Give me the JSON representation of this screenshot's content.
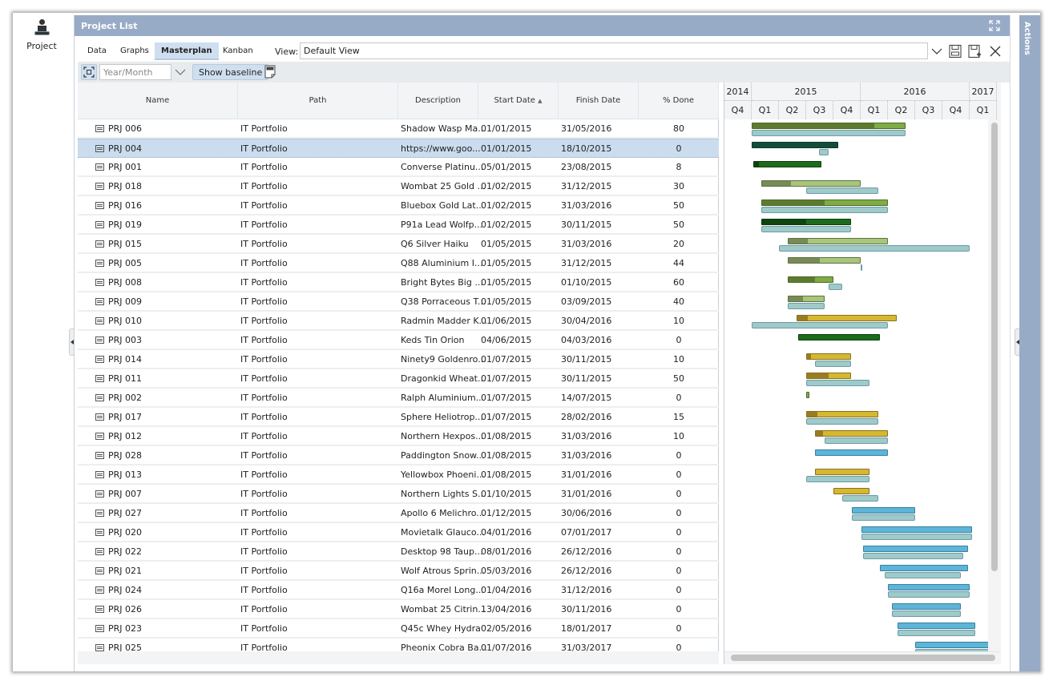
{
  "left_nav": {
    "item_label": "Project"
  },
  "panel": {
    "title": "Project List"
  },
  "tabs": [
    {
      "label": "Data",
      "active": false
    },
    {
      "label": "Graphs",
      "active": false
    },
    {
      "label": "Masterplan",
      "active": true
    },
    {
      "label": "Kanban",
      "active": false
    }
  ],
  "view": {
    "label": "View:",
    "value": "Default View"
  },
  "toolbar": {
    "scale_placeholder": "Year/Month",
    "show_baseline_label": "Show baseline"
  },
  "actions_label": "Actions",
  "grid": {
    "columns": [
      "Name",
      "Path",
      "Description",
      "Start Date",
      "Finish Date",
      "% Done"
    ],
    "sort": {
      "column": "Start Date",
      "direction": "asc",
      "indicator": "▲"
    },
    "selected_row": 1,
    "rows": [
      {
        "name": "PRJ 006",
        "path": "IT Portfolio",
        "description": "Shadow Wasp Ma...",
        "start": "01/01/2015",
        "finish": "31/05/2016",
        "done": "80"
      },
      {
        "name": "PRJ 004",
        "path": "IT Portfolio",
        "description": "https://www.goo...",
        "start": "01/01/2015",
        "finish": "18/10/2015",
        "done": "0"
      },
      {
        "name": "PRJ 001",
        "path": "IT Portfolio",
        "description": "Converse Platinu...",
        "start": "05/01/2015",
        "finish": "23/08/2015",
        "done": "8"
      },
      {
        "name": "PRJ 018",
        "path": "IT Portfolio",
        "description": "Wombat 25 Gold ...",
        "start": "01/02/2015",
        "finish": "31/12/2015",
        "done": "30"
      },
      {
        "name": "PRJ 016",
        "path": "IT Portfolio",
        "description": "Bluebox Gold Lat...",
        "start": "01/02/2015",
        "finish": "31/03/2016",
        "done": "50"
      },
      {
        "name": "PRJ 019",
        "path": "IT Portfolio",
        "description": "P91a Lead Wolfp...",
        "start": "01/02/2015",
        "finish": "30/11/2015",
        "done": "50"
      },
      {
        "name": "PRJ 015",
        "path": "IT Portfolio",
        "description": "Q6 Silver Haiku",
        "start": "01/05/2015",
        "finish": "31/03/2016",
        "done": "20"
      },
      {
        "name": "PRJ 005",
        "path": "IT Portfolio",
        "description": "Q88 Aluminium I...",
        "start": "01/05/2015",
        "finish": "31/12/2015",
        "done": "44"
      },
      {
        "name": "PRJ 008",
        "path": "IT Portfolio",
        "description": "Bright Bytes Big ...",
        "start": "01/05/2015",
        "finish": "01/10/2015",
        "done": "60"
      },
      {
        "name": "PRJ 009",
        "path": "IT Portfolio",
        "description": "Q38 Porraceous T...",
        "start": "01/05/2015",
        "finish": "03/09/2015",
        "done": "40"
      },
      {
        "name": "PRJ 010",
        "path": "IT Portfolio",
        "description": "Radmin Madder K...",
        "start": "01/06/2015",
        "finish": "30/04/2016",
        "done": "10"
      },
      {
        "name": "PRJ 003",
        "path": "IT Portfolio",
        "description": "Keds Tin Orion",
        "start": "04/06/2015",
        "finish": "04/03/2016",
        "done": "0"
      },
      {
        "name": "PRJ 014",
        "path": "IT Portfolio",
        "description": "Ninety9 Goldenro...",
        "start": "01/07/2015",
        "finish": "30/11/2015",
        "done": "10"
      },
      {
        "name": "PRJ 011",
        "path": "IT Portfolio",
        "description": "Dragonkid Wheat...",
        "start": "01/07/2015",
        "finish": "30/11/2015",
        "done": "50"
      },
      {
        "name": "PRJ 002",
        "path": "IT Portfolio",
        "description": "Ralph Aluminium...",
        "start": "01/07/2015",
        "finish": "14/07/2015",
        "done": "0"
      },
      {
        "name": "PRJ 017",
        "path": "IT Portfolio",
        "description": "Sphere Heliotrop...",
        "start": "01/07/2015",
        "finish": "28/02/2016",
        "done": "15"
      },
      {
        "name": "PRJ 012",
        "path": "IT Portfolio",
        "description": "Northern Hexpos...",
        "start": "01/08/2015",
        "finish": "31/03/2016",
        "done": "10"
      },
      {
        "name": "PRJ 028",
        "path": "IT Portfolio",
        "description": "Paddington Snow...",
        "start": "01/08/2015",
        "finish": "31/03/2016",
        "done": "0"
      },
      {
        "name": "PRJ 013",
        "path": "IT Portfolio",
        "description": "Yellowbox Phoeni...",
        "start": "01/08/2015",
        "finish": "31/01/2016",
        "done": "0"
      },
      {
        "name": "PRJ 007",
        "path": "IT Portfolio",
        "description": "Northern Lights S...",
        "start": "01/10/2015",
        "finish": "31/01/2016",
        "done": "0"
      },
      {
        "name": "PRJ 027",
        "path": "IT Portfolio",
        "description": "Apollo 6 Melichro...",
        "start": "01/12/2015",
        "finish": "30/06/2016",
        "done": "0"
      },
      {
        "name": "PRJ 020",
        "path": "IT Portfolio",
        "description": "Movietalk Glauco...",
        "start": "04/01/2016",
        "finish": "07/01/2017",
        "done": "0"
      },
      {
        "name": "PRJ 022",
        "path": "IT Portfolio",
        "description": "Desktop 98 Taup...",
        "start": "08/01/2016",
        "finish": "26/12/2016",
        "done": "0"
      },
      {
        "name": "PRJ 021",
        "path": "IT Portfolio",
        "description": "Wolf Atrous Sprin...",
        "start": "05/03/2016",
        "finish": "26/12/2016",
        "done": "0"
      },
      {
        "name": "PRJ 024",
        "path": "IT Portfolio",
        "description": "Q16a Morel Long...",
        "start": "01/04/2016",
        "finish": "31/12/2016",
        "done": "0"
      },
      {
        "name": "PRJ 026",
        "path": "IT Portfolio",
        "description": "Wombat 25 Citrin...",
        "start": "13/04/2016",
        "finish": "30/11/2016",
        "done": "0"
      },
      {
        "name": "PRJ 023",
        "path": "IT Portfolio",
        "description": "Q45c Whey Hydra",
        "start": "02/05/2016",
        "finish": "18/01/2017",
        "done": "0"
      },
      {
        "name": "PRJ 025",
        "path": "IT Portfolio",
        "description": "Pheonix Cobra Ba...",
        "start": "01/07/2016",
        "finish": "31/03/2017",
        "done": "0"
      }
    ]
  },
  "gantt": {
    "years": [
      {
        "label": "2014",
        "quarters": 1
      },
      {
        "label": "2015",
        "quarters": 4
      },
      {
        "label": "2016",
        "quarters": 4
      },
      {
        "label": "2017",
        "quarters": 1
      }
    ],
    "quarters": [
      "Q4",
      "Q1",
      "Q2",
      "Q3",
      "Q4",
      "Q1",
      "Q2",
      "Q3",
      "Q4",
      "Q1"
    ],
    "timeline_start": "2014-10-01",
    "timeline_end": "2017-04-01",
    "palettes": {
      "olive": {
        "fill": "#7fac44",
        "prog": "#5d7b30",
        "border": "#4f6a28"
      },
      "sage": {
        "fill": "#a7c67b",
        "prog": "#778a57",
        "border": "#5f7240"
      },
      "dark-teal": {
        "fill": "#134d38",
        "prog": "#134d38",
        "border": "#0d3a2a"
      },
      "forest": {
        "fill": "#1d6b1d",
        "prog": "#0f4010",
        "border": "#0f4010"
      },
      "dark-forest": {
        "fill": "#1d6b1d",
        "prog": "#0e4510",
        "border": "#0e3d0e"
      },
      "gold": {
        "fill": "#d6b830",
        "prog": "#9a7c20",
        "border": "#8a7020"
      },
      "sky": {
        "fill": "#5db5d8",
        "prog": "#5db5d8",
        "border": "#3a7fa0"
      },
      "lime-mini": {
        "fill": "#7fac44",
        "prog": "#7fac44",
        "border": "#4f6a28"
      }
    },
    "baseline_color": "#9ecac8",
    "tasks": [
      {
        "start": "2015-01-01",
        "end": "2016-05-31",
        "progress": 80,
        "palette": "olive",
        "baseline": [
          "2015-01-01",
          "2016-05-31"
        ]
      },
      {
        "start": "2015-01-01",
        "end": "2015-10-18",
        "progress": 0,
        "palette": "dark-teal",
        "baseline": [
          "2015-08-15",
          "2015-09-15"
        ]
      },
      {
        "start": "2015-01-05",
        "end": "2015-08-23",
        "progress": 8,
        "palette": "forest",
        "baseline": null
      },
      {
        "start": "2015-02-01",
        "end": "2015-12-31",
        "progress": 30,
        "palette": "sage",
        "baseline": [
          "2015-07-01",
          "2016-02-28"
        ]
      },
      {
        "start": "2015-02-01",
        "end": "2016-03-31",
        "progress": 50,
        "palette": "olive",
        "baseline": [
          "2015-02-01",
          "2016-03-31"
        ]
      },
      {
        "start": "2015-02-01",
        "end": "2015-11-30",
        "progress": 50,
        "palette": "dark-forest",
        "baseline": [
          "2015-02-01",
          "2015-11-30"
        ]
      },
      {
        "start": "2015-05-01",
        "end": "2016-03-31",
        "progress": 20,
        "palette": "sage",
        "baseline": [
          "2015-04-01",
          "2016-12-31"
        ]
      },
      {
        "start": "2015-05-01",
        "end": "2015-12-31",
        "progress": 44,
        "palette": "sage",
        "baseline": [
          "2015-12-31",
          "2016-01-02"
        ]
      },
      {
        "start": "2015-05-01",
        "end": "2015-10-01",
        "progress": 60,
        "palette": "olive",
        "baseline": [
          "2015-09-15",
          "2015-11-01"
        ]
      },
      {
        "start": "2015-05-01",
        "end": "2015-09-03",
        "progress": 40,
        "palette": "sage",
        "baseline": [
          "2015-05-01",
          "2015-09-03"
        ]
      },
      {
        "start": "2015-06-01",
        "end": "2016-04-30",
        "progress": 10,
        "palette": "gold",
        "baseline": [
          "2015-01-01",
          "2016-03-31"
        ]
      },
      {
        "start": "2015-06-04",
        "end": "2016-03-04",
        "progress": 0,
        "palette": "forest",
        "baseline": null
      },
      {
        "start": "2015-07-01",
        "end": "2015-11-30",
        "progress": 10,
        "palette": "gold",
        "baseline": [
          "2015-08-01",
          "2015-11-30"
        ]
      },
      {
        "start": "2015-07-01",
        "end": "2015-11-30",
        "progress": 50,
        "palette": "gold",
        "baseline": [
          "2015-07-01",
          "2016-01-31"
        ]
      },
      {
        "start": "2015-07-01",
        "end": "2015-07-14",
        "progress": 0,
        "palette": "lime-mini",
        "baseline": null
      },
      {
        "start": "2015-07-01",
        "end": "2016-02-28",
        "progress": 15,
        "palette": "gold",
        "baseline": [
          "2015-07-01",
          "2016-02-28"
        ]
      },
      {
        "start": "2015-08-01",
        "end": "2016-03-31",
        "progress": 10,
        "palette": "gold",
        "baseline": [
          "2015-09-01",
          "2016-03-31"
        ]
      },
      {
        "start": "2015-08-01",
        "end": "2016-03-31",
        "progress": 0,
        "palette": "sky",
        "baseline": null
      },
      {
        "start": "2015-08-01",
        "end": "2016-01-31",
        "progress": 0,
        "palette": "gold",
        "baseline": [
          "2015-07-01",
          "2016-01-31"
        ]
      },
      {
        "start": "2015-10-01",
        "end": "2016-01-31",
        "progress": 0,
        "palette": "gold",
        "baseline": [
          "2015-11-01",
          "2016-02-28"
        ]
      },
      {
        "start": "2015-12-01",
        "end": "2016-06-30",
        "progress": 0,
        "palette": "sky",
        "baseline": [
          "2015-12-01",
          "2016-06-30"
        ]
      },
      {
        "start": "2016-01-04",
        "end": "2017-01-07",
        "progress": 0,
        "palette": "sky",
        "baseline": [
          "2016-01-04",
          "2017-01-07"
        ]
      },
      {
        "start": "2016-01-08",
        "end": "2016-12-26",
        "progress": 0,
        "palette": "sky",
        "baseline": [
          "2016-01-08",
          "2016-12-10"
        ]
      },
      {
        "start": "2016-03-05",
        "end": "2016-12-26",
        "progress": 0,
        "palette": "sky",
        "baseline": [
          "2016-03-20",
          "2016-12-01"
        ]
      },
      {
        "start": "2016-04-01",
        "end": "2016-12-31",
        "progress": 0,
        "palette": "sky",
        "baseline": [
          "2016-04-01",
          "2016-12-31"
        ]
      },
      {
        "start": "2016-04-13",
        "end": "2016-11-30",
        "progress": 0,
        "palette": "sky",
        "baseline": [
          "2016-04-13",
          "2016-11-30"
        ]
      },
      {
        "start": "2016-05-02",
        "end": "2017-01-18",
        "progress": 0,
        "palette": "sky",
        "baseline": [
          "2016-05-02",
          "2017-01-18"
        ]
      },
      {
        "start": "2016-07-01",
        "end": "2017-03-31",
        "progress": 0,
        "palette": "sky",
        "baseline": [
          "2016-07-01",
          "2017-03-31"
        ]
      }
    ]
  }
}
